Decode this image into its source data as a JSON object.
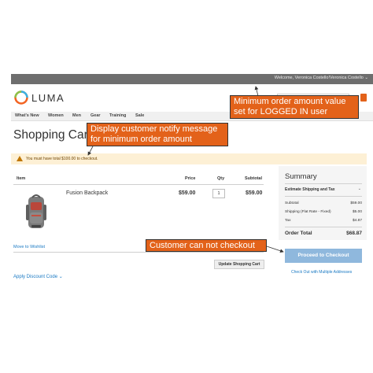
{
  "topbar": {
    "welcome": "Welcome, Veronica Costello!",
    "user": "Veronica Costello ⌄"
  },
  "header": {
    "logo": "LUMA"
  },
  "nav": {
    "items": [
      "What's New",
      "Women",
      "Men",
      "Gear",
      "Training",
      "Sale"
    ]
  },
  "page": {
    "title": "Shopping Cart"
  },
  "notice": {
    "text": "You must have total $100.00 to checkout."
  },
  "cart_table": {
    "headers": {
      "item": "Item",
      "price": "Price",
      "qty": "Qty",
      "subtotal": "Subtotal"
    },
    "rows": [
      {
        "name": "Fusion Backpack",
        "price": "$59.00",
        "qty": "1",
        "subtotal": "$59.00"
      }
    ],
    "move_to_wishlist": "Move to Wishlist",
    "update_button": "Update Shopping Cart",
    "discount_link": "Apply Discount Code ⌄"
  },
  "summary": {
    "title": "Summary",
    "estimate": "Estimate Shipping and Tax",
    "estimate_chevron": "⌄",
    "rows": [
      {
        "label": "Subtotal",
        "value": "$59.00"
      },
      {
        "label": "Shipping (Flat Rate - Fixed)",
        "value": "$5.00"
      },
      {
        "label": "Tax",
        "value": "$4.87"
      }
    ],
    "order_total_label": "Order Total",
    "order_total_value": "$68.87",
    "checkout_button": "Proceed to Checkout",
    "multi_address": "Check Out with Multiple Addresses"
  },
  "annotations": {
    "callout_1_line1": "Minimum order amount value",
    "callout_1_line2": "set for LOGGED IN user",
    "callout_2_line1": "Display customer notify message",
    "callout_2_line2": "for minimum order amount",
    "callout_3": "Customer can not checkout"
  },
  "colors": {
    "accent": "#e3621a",
    "checkout_disabled": "#8fb8dd",
    "link": "#1979c3",
    "notice_bg": "#fdf0d5"
  }
}
